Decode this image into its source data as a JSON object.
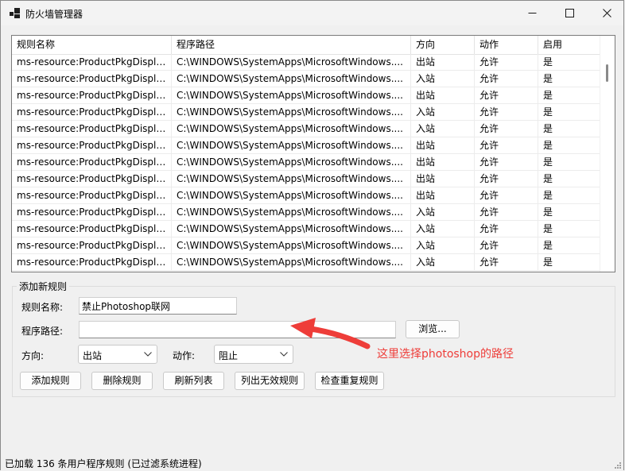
{
  "window": {
    "title": "防火墙管理器"
  },
  "grid": {
    "columns": [
      "规则名称",
      "程序路径",
      "方向",
      "动作",
      "启用"
    ],
    "rows": [
      [
        "ms-resource:ProductPkgDispla...",
        "C:\\WINDOWS\\SystemApps\\MicrosoftWindows....",
        "出站",
        "允许",
        "是"
      ],
      [
        "ms-resource:ProductPkgDispla...",
        "C:\\WINDOWS\\SystemApps\\MicrosoftWindows....",
        "入站",
        "允许",
        "是"
      ],
      [
        "ms-resource:ProductPkgDispla...",
        "C:\\WINDOWS\\SystemApps\\MicrosoftWindows....",
        "出站",
        "允许",
        "是"
      ],
      [
        "ms-resource:ProductPkgDispla...",
        "C:\\WINDOWS\\SystemApps\\MicrosoftWindows....",
        "入站",
        "允许",
        "是"
      ],
      [
        "ms-resource:ProductPkgDispla...",
        "C:\\WINDOWS\\SystemApps\\MicrosoftWindows....",
        "入站",
        "允许",
        "是"
      ],
      [
        "ms-resource:ProductPkgDispla...",
        "C:\\WINDOWS\\SystemApps\\MicrosoftWindows....",
        "出站",
        "允许",
        "是"
      ],
      [
        "ms-resource:ProductPkgDispla...",
        "C:\\WINDOWS\\SystemApps\\MicrosoftWindows....",
        "出站",
        "允许",
        "是"
      ],
      [
        "ms-resource:ProductPkgDispla...",
        "C:\\WINDOWS\\SystemApps\\MicrosoftWindows....",
        "出站",
        "允许",
        "是"
      ],
      [
        "ms-resource:ProductPkgDispla...",
        "C:\\WINDOWS\\SystemApps\\MicrosoftWindows....",
        "出站",
        "允许",
        "是"
      ],
      [
        "ms-resource:ProductPkgDispla...",
        "C:\\WINDOWS\\SystemApps\\MicrosoftWindows....",
        "入站",
        "允许",
        "是"
      ],
      [
        "ms-resource:ProductPkgDispla...",
        "C:\\WINDOWS\\SystemApps\\MicrosoftWindows....",
        "入站",
        "允许",
        "是"
      ],
      [
        "ms-resource:ProductPkgDispla...",
        "C:\\WINDOWS\\SystemApps\\MicrosoftWindows....",
        "入站",
        "允许",
        "是"
      ],
      [
        "ms-resource:ProductPkgDispla...",
        "C:\\WINDOWS\\SystemApps\\MicrosoftWindows....",
        "入站",
        "允许",
        "是"
      ]
    ]
  },
  "form": {
    "group_title": "添加新规则",
    "rule_name_label": "规则名称:",
    "rule_name_value": "禁止Photoshop联网",
    "path_label": "程序路径:",
    "path_value": "",
    "browse_label": "浏览...",
    "direction_label": "方向:",
    "direction_value": "出站",
    "action_label": "动作:",
    "action_value": "阻止"
  },
  "buttons": {
    "add": "添加规则",
    "delete": "删除规则",
    "refresh": "刷新列表",
    "list_invalid": "列出无效规则",
    "check_duplicate": "检查重复规则"
  },
  "annotation": {
    "text": "这里选择photoshop的路径",
    "color": "#ee3d39"
  },
  "status": {
    "text": "已加载 136 条用户程序规则 (已过滤系统进程)"
  },
  "icons": {
    "app": "app-icon",
    "minimize": "minimize-icon",
    "maximize": "maximize-icon",
    "close": "close-icon",
    "combo_arrow": "chevron-down-icon",
    "annotation_arrow": "arrow-icon",
    "grip": "resize-grip-icon"
  }
}
